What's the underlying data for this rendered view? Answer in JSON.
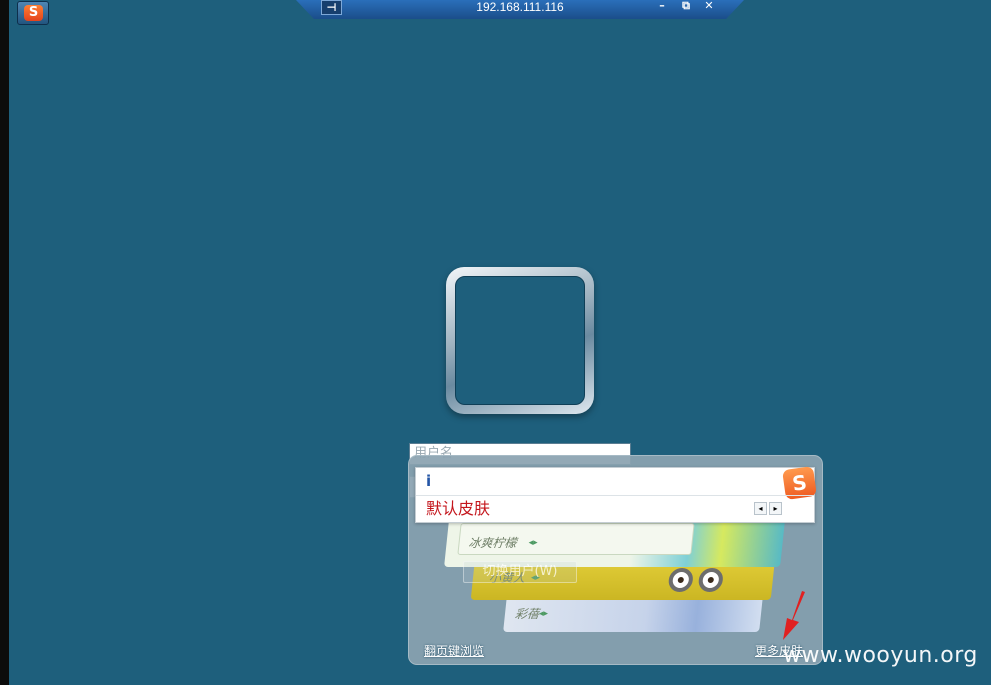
{
  "rdp_bar": {
    "title": "192.168.111.116",
    "pin_label": "⊣",
    "minimize_label": "–",
    "restore_label": "⧉",
    "close_label": "✕"
  },
  "tray": {
    "sogou_label": "S"
  },
  "login": {
    "username_placeholder": "用户名",
    "switch_user_label": "切换用户(W)"
  },
  "ime": {
    "input_text": "i",
    "candidate": "默认皮肤",
    "logo_label": "S",
    "prev_label": "◂",
    "next_label": "▸"
  },
  "skin_panel": {
    "cards": [
      {
        "label": "冰爽柠檬"
      },
      {
        "label": "小黄人"
      },
      {
        "label": "彩蓓"
      }
    ],
    "card_arrow": "◂▸",
    "page_browse_label": "翻页键浏览",
    "more_skins_label": "更多皮肤"
  },
  "watermark": {
    "text": "www.wooyun.org"
  },
  "colors": {
    "desktop": "#1e5f7c",
    "rdp_bar": "#2a6fba",
    "candidate": "#c4161c",
    "arrow": "#e02020"
  }
}
